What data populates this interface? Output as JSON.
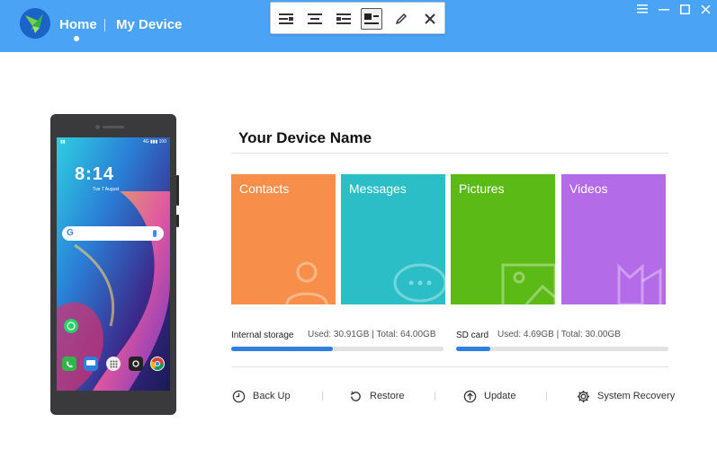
{
  "header": {
    "nav": {
      "home": "Home",
      "my_device": "My Device"
    },
    "toolbar": {
      "buttons": [
        "align-left-icon",
        "align-center-icon",
        "align-right-icon",
        "align-top-left-icon",
        "pencil-icon",
        "close-icon"
      ],
      "active": "align-top-left-icon"
    },
    "window_controls": [
      "menu-icon",
      "minimize-icon",
      "maximize-icon",
      "close-icon"
    ]
  },
  "phone": {
    "clock": "8:14",
    "date": "Tue 7 August",
    "status_right": "4G ▮▮▮ 100",
    "search_letter": "G",
    "apps": [
      "whatsapp",
      "phone",
      "messages",
      "apps",
      "camera",
      "chrome"
    ]
  },
  "main": {
    "title": "Your Device Name",
    "tiles": [
      {
        "label": "Contacts",
        "color": "#f78f4a"
      },
      {
        "label": "Messages",
        "color": "#2bbec6"
      },
      {
        "label": "Pictures",
        "color": "#5cba16"
      },
      {
        "label": "Videos",
        "color": "#b46be8"
      }
    ],
    "storage": {
      "internal": {
        "label": "Internal storage",
        "detail": "Used: 30.91GB | Total: 64.00GB",
        "used_fraction": 0.48
      },
      "sd": {
        "label": "SD card",
        "detail": "Used: 4.69GB | Total: 30.00GB",
        "used_fraction": 0.16
      }
    },
    "actions": [
      {
        "label": "Back Up",
        "icon": "backup-icon"
      },
      {
        "label": "Restore",
        "icon": "restore-icon"
      },
      {
        "label": "Update",
        "icon": "update-icon"
      },
      {
        "label": "System Recovery",
        "icon": "gear-icon"
      }
    ]
  },
  "colors": {
    "header": "#4aa3f4",
    "progress": "#2f7fe0"
  }
}
